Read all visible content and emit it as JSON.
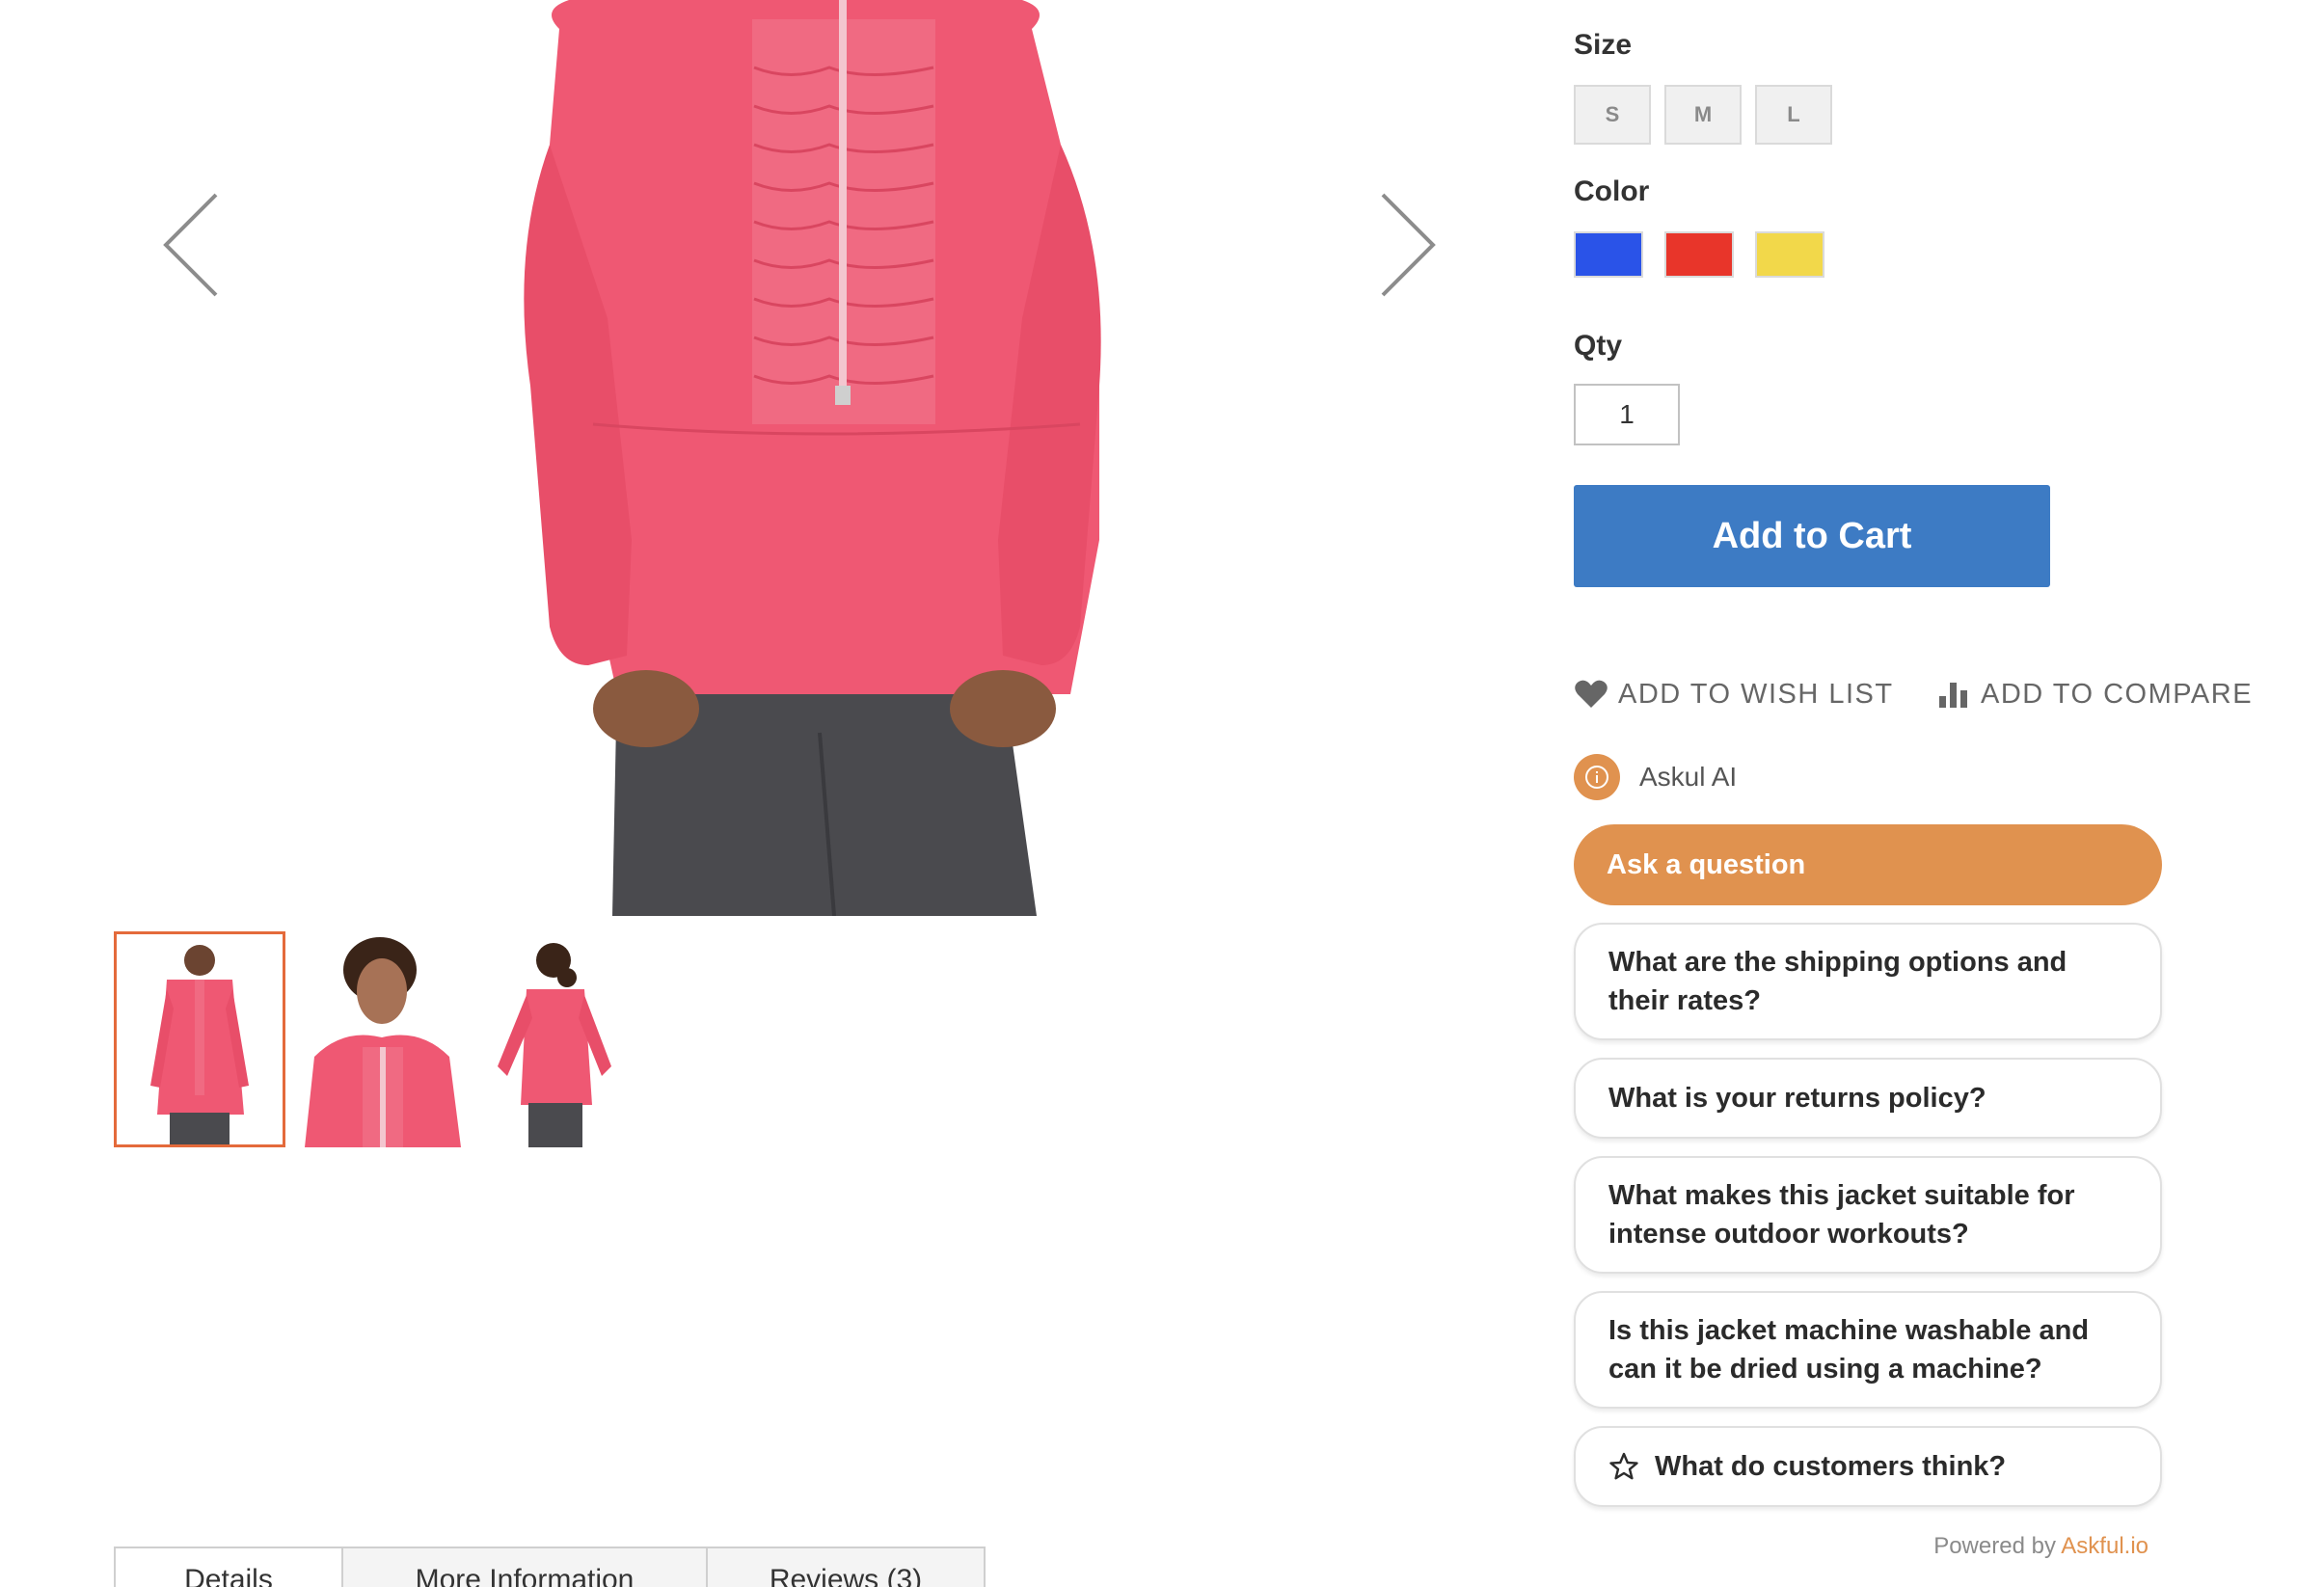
{
  "gallery": {
    "prev_label": "Previous",
    "next_label": "Next"
  },
  "tabs": [
    {
      "label": "Details"
    },
    {
      "label": "More Information"
    },
    {
      "label": "Reviews (3)"
    }
  ],
  "size": {
    "label": "Size",
    "options": [
      "S",
      "M",
      "L"
    ]
  },
  "color": {
    "label": "Color",
    "swatches": [
      "#2a53e8",
      "#e8352a",
      "#f2d84a"
    ]
  },
  "qty": {
    "label": "Qty",
    "value": "1"
  },
  "cart": {
    "button_label": "Add to Cart",
    "button_color": "#3d7bc4"
  },
  "actions": {
    "wishlist_label": "ADD TO WISH LIST",
    "compare_label": "ADD TO COMPARE"
  },
  "askul": {
    "name": "Askul AI",
    "accent": "#e0924f",
    "ask_label": "Ask a question",
    "questions": [
      "What are the shipping options and their rates?",
      "What is your returns policy?",
      "What makes this jacket suitable for intense outdoor workouts?",
      "Is this jacket machine washable and can it be dried using a machine?",
      "What do customers think?"
    ],
    "powered_by": "Powered by",
    "powered_brand": "Askful.io",
    "powered_brand_color": "#e0924f"
  },
  "colors": {
    "jacket": "#ef5873",
    "thumb_active_border": "#e46a3b"
  }
}
